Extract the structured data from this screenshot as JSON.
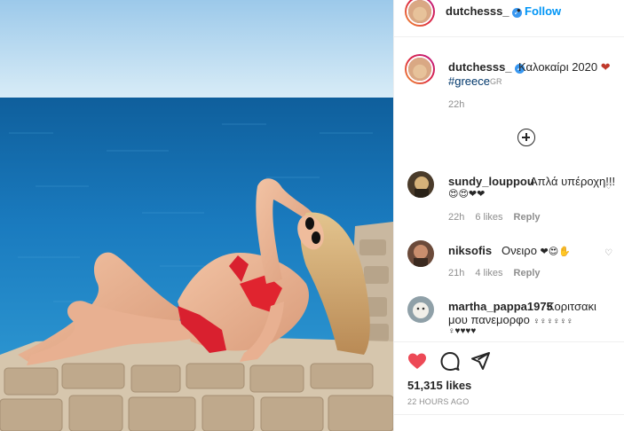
{
  "post": {
    "username": "dutchesss_",
    "dot": "•",
    "follow_label": "Follow",
    "verified_icon": "✓"
  },
  "caption": {
    "username": "dutchesss_",
    "text": "Καλοκαίρι 2020",
    "heart": "❤",
    "hashtag": "#greece",
    "hashtag_suffix": "GR",
    "time": "22h"
  },
  "comments": [
    {
      "username": "sundy_louppou",
      "text": "Απλά υπέροχη!!!",
      "emoji": "😍😍❤❤",
      "time": "22h",
      "likes": "6 likes",
      "reply": "Reply"
    },
    {
      "username": "niksofis",
      "text": "Ονειρο",
      "emoji": "❤😍✋",
      "time": "21h",
      "likes": "4 likes",
      "reply": "Reply"
    },
    {
      "username": "martha_pappa1975",
      "text": "Κοριτσακι",
      "text2": "μου πανεμορφο",
      "emoji": "♀♀♀♀♀♀",
      "emoji2": "♀♥♥♥♥"
    }
  ],
  "actions": {
    "likes": "51,315 likes",
    "posted": "22 HOURS AGO"
  },
  "colors": {
    "link_blue": "#0095f6",
    "like_red": "#ed4956",
    "hashtag": "#00376b",
    "muted": "#8e8e8e"
  },
  "icons": [
    "heart-icon",
    "comment-icon",
    "share-icon",
    "add-comment-icon",
    "verified-icon",
    "comment-like-icon"
  ]
}
